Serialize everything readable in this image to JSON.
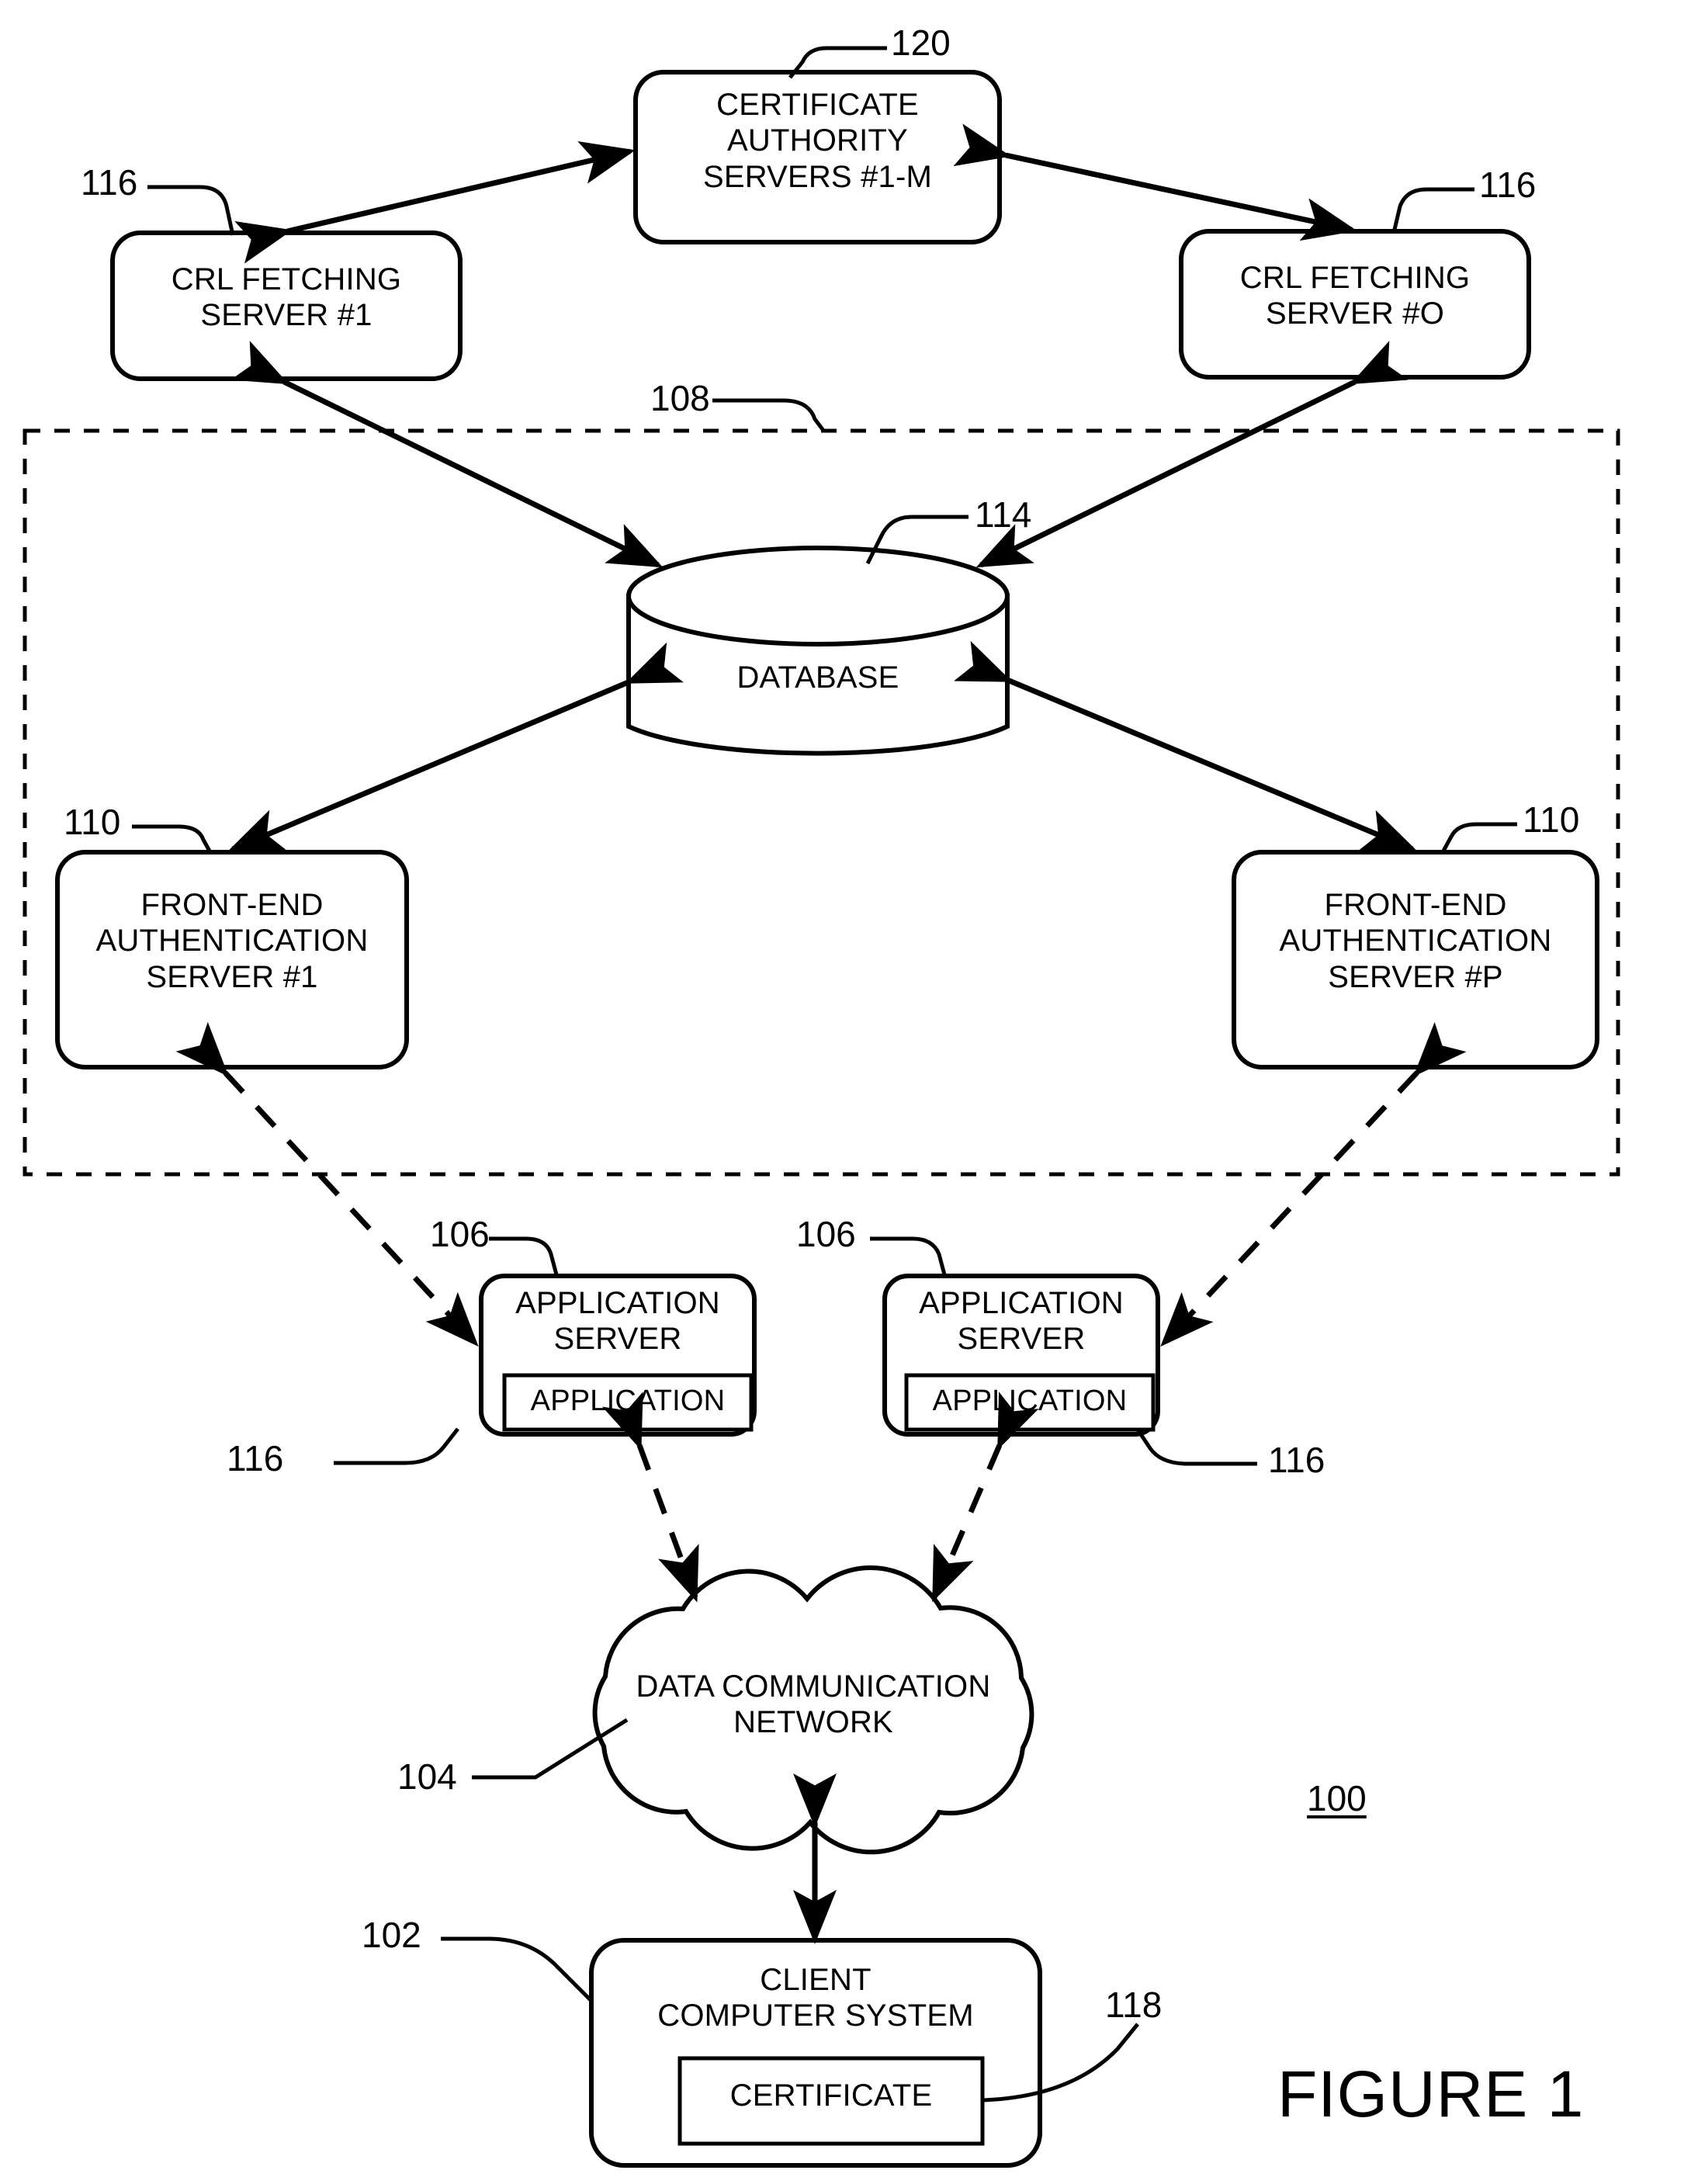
{
  "figure": {
    "title": "FIGURE 1",
    "system_ref": "100"
  },
  "nodes": {
    "certificate_authority": {
      "label": "CERTIFICATE\nAUTHORITY\nSERVERS #1-M",
      "ref": "120"
    },
    "crl_fetching_server_1": {
      "label": "CRL FETCHING\nSERVER #1",
      "ref": "116"
    },
    "crl_fetching_server_o": {
      "label": "CRL FETCHING\nSERVER #O",
      "ref": "116"
    },
    "database": {
      "label": "DATABASE",
      "ref": "114"
    },
    "authentication_system": {
      "ref": "108"
    },
    "front_end_auth_server_1": {
      "label": "FRONT-END\nAUTHENTICATION\nSERVER #1",
      "ref": "110"
    },
    "front_end_auth_server_p": {
      "label": "FRONT-END\nAUTHENTICATION\nSERVER #P",
      "ref": "110"
    },
    "application_server_left": {
      "label": "APPLICATION\nSERVER",
      "inner_label": "APPLICATION",
      "ref": "106",
      "inner_ref": "116"
    },
    "application_server_right": {
      "label": "APPLICATION\nSERVER",
      "inner_label": "APPLICATION",
      "ref": "106",
      "inner_ref": "116"
    },
    "network_cloud": {
      "label": "DATA COMMUNICATION\nNETWORK",
      "ref": "104"
    },
    "client_computer_system": {
      "label": "CLIENT\nCOMPUTER SYSTEM",
      "inner_label": "CERTIFICATE",
      "ref": "102",
      "inner_ref": "118"
    }
  },
  "colors": {
    "line": "#000000",
    "background": "#ffffff"
  }
}
